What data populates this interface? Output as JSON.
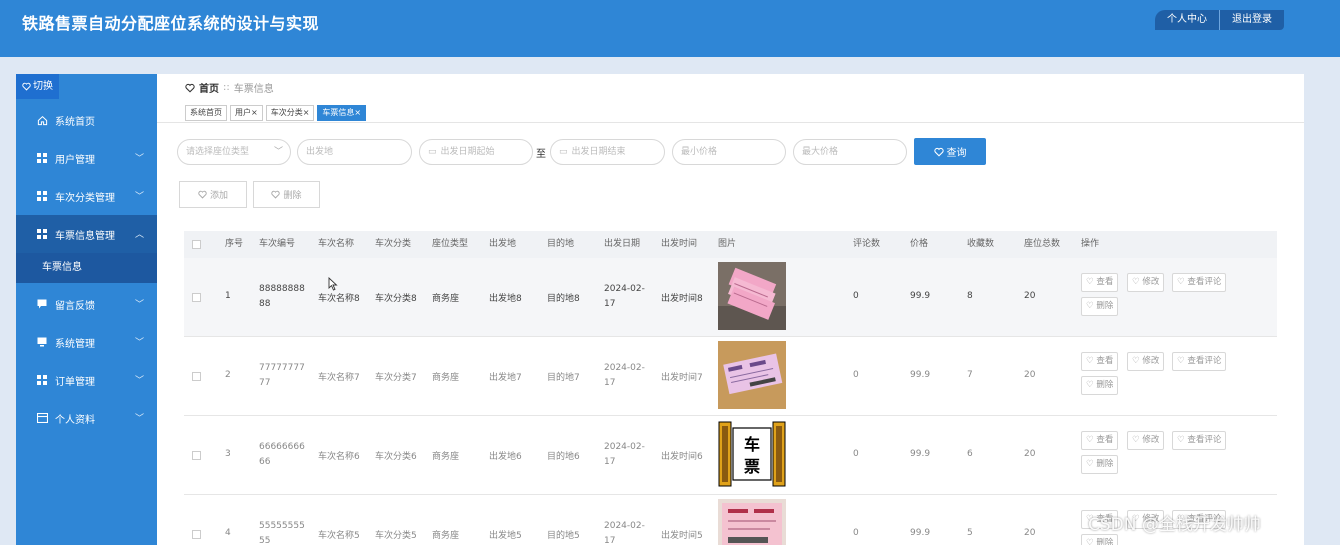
{
  "app": {
    "title": "铁路售票自动分配座位系统的设计与实现"
  },
  "topbar": {
    "personal_center": "个人中心",
    "logout": "退出登录"
  },
  "sidebar": {
    "switch_label": "切换",
    "items": [
      {
        "label": "系统首页",
        "icon": "home-icon",
        "has_chevron": false
      },
      {
        "label": "用户管理",
        "icon": "grid-icon",
        "has_chevron": true
      },
      {
        "label": "车次分类管理",
        "icon": "grid-icon",
        "has_chevron": true
      },
      {
        "label": "车票信息管理",
        "icon": "grid-icon",
        "has_chevron": true
      },
      {
        "label": "留言反馈",
        "icon": "chat-icon",
        "has_chevron": true
      },
      {
        "label": "系统管理",
        "icon": "monitor-icon",
        "has_chevron": true
      },
      {
        "label": "订单管理",
        "icon": "grid-icon",
        "has_chevron": true
      },
      {
        "label": "个人资料",
        "icon": "card-icon",
        "has_chevron": true
      }
    ],
    "active_submenu": "车票信息"
  },
  "breadcrumb": {
    "home": "首页",
    "separator": "::",
    "current": "车票信息"
  },
  "tabs": [
    {
      "label": "系统首页"
    },
    {
      "label": "用户×"
    },
    {
      "label": "车次分类×"
    },
    {
      "label": "车票信息×"
    }
  ],
  "filters": {
    "seat_type_placeholder": "请选择座位类型",
    "departure_placeholder": "出发地",
    "date_start_placeholder": "出发日期起始",
    "to_label": "至",
    "date_end_placeholder": "出发日期结束",
    "min_price_placeholder": "最小价格",
    "max_price_placeholder": "最大价格",
    "query_label": "查询"
  },
  "actions": {
    "add_label": "添加",
    "delete_label": "删除"
  },
  "table": {
    "headers": [
      "序号",
      "车次编号",
      "车次名称",
      "车次分类",
      "座位类型",
      "出发地",
      "目的地",
      "出发日期",
      "出发时间",
      "图片",
      "评论数",
      "价格",
      "收藏数",
      "座位总数",
      "操作"
    ],
    "op_labels": {
      "view": "查看",
      "edit": "修改",
      "view_comments": "查看评论",
      "delete": "删除"
    },
    "rows": [
      {
        "index": "1",
        "train_no": "8888888888",
        "train_name": "车次名称8",
        "category": "车次分类8",
        "seat_type": "商务座",
        "from": "出发地8",
        "to": "目的地8",
        "date": "2024-02-17",
        "time": "出发时间8",
        "comments": "0",
        "price": "99.9",
        "favorites": "8",
        "seats": "20"
      },
      {
        "index": "2",
        "train_no": "7777777777",
        "train_name": "车次名称7",
        "category": "车次分类7",
        "seat_type": "商务座",
        "from": "出发地7",
        "to": "目的地7",
        "date": "2024-02-17",
        "time": "出发时间7",
        "comments": "0",
        "price": "99.9",
        "favorites": "7",
        "seats": "20"
      },
      {
        "index": "3",
        "train_no": "6666666666",
        "train_name": "车次名称6",
        "category": "车次分类6",
        "seat_type": "商务座",
        "from": "出发地6",
        "to": "目的地6",
        "date": "2024-02-17",
        "time": "出发时间6",
        "comments": "0",
        "price": "99.9",
        "favorites": "6",
        "seats": "20"
      },
      {
        "index": "4",
        "train_no": "5555555555",
        "train_name": "车次名称5",
        "category": "车次分类5",
        "seat_type": "商务座",
        "from": "出发地5",
        "to": "目的地5",
        "date": "2024-02-17",
        "time": "出发时间5",
        "comments": "0",
        "price": "99.9",
        "favorites": "5",
        "seats": "20"
      }
    ]
  },
  "thumb_text": {
    "che": "车",
    "piao": "票"
  },
  "watermark": "CSDN @全栈开发帅帅",
  "colors": {
    "primary": "#2f86d6",
    "sidebar_active": "#1f5fa6",
    "background": "#dfe8f4"
  }
}
